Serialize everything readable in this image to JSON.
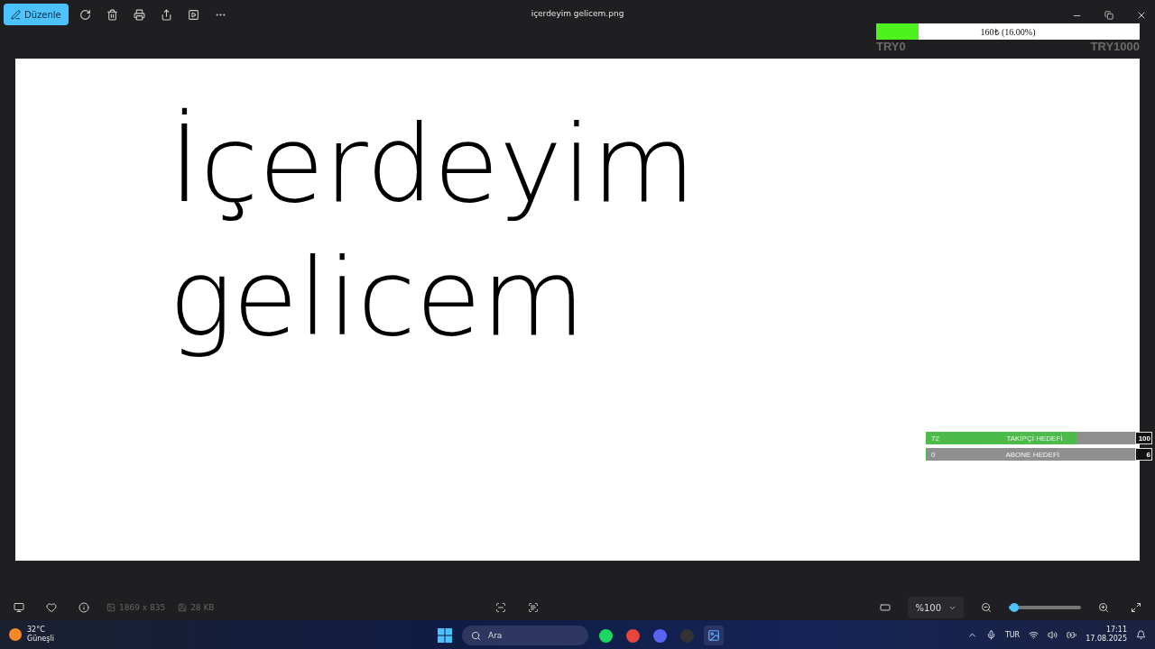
{
  "window": {
    "title": "içerdeyim gelicem.png"
  },
  "toolbar": {
    "edit_button": "Düzenle"
  },
  "image": {
    "lines": [
      "İçerdeyim",
      "gelicem"
    ]
  },
  "donation_bar": {
    "label": "160₺ (16.00%)",
    "level": 0.16,
    "min": "TRY0",
    "max": "TRY1000"
  },
  "goals": [
    {
      "current": "72",
      "label": "TAKİPÇİ HEDEFİ",
      "target": "100",
      "level": 0.72
    },
    {
      "current": "0",
      "label": "ABONE HEDEFİ",
      "target": "6",
      "level": 0
    }
  ],
  "status_bar": {
    "dimensions": "1869 x 835",
    "size": "28 KB",
    "zoom": "%100",
    "zoom_slider": {
      "level": 0.08
    }
  },
  "taskbar": {
    "weather_temp": "32°C",
    "weather_text": "Güneşli",
    "search_placeholder": "Ara",
    "language": "TUR",
    "time": "17:11",
    "date": "17.08.2025"
  }
}
